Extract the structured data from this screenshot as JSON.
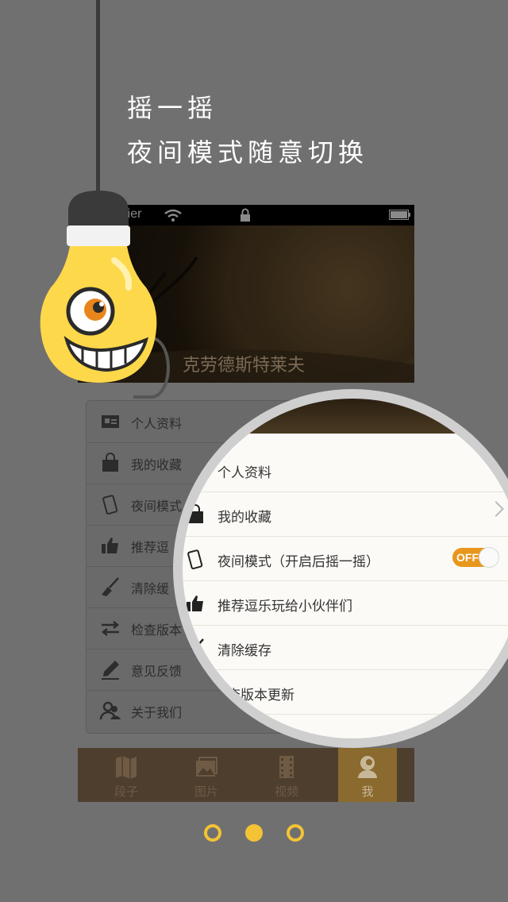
{
  "headline": {
    "line1": "摇一摇",
    "line2": "夜间模式随意切换"
  },
  "phone": {
    "status": {
      "carrier": "rrier"
    },
    "profile": {
      "username": "克劳德斯特莱夫"
    },
    "menu": [
      {
        "label": "个人资料",
        "icon": "profile-card-icon"
      },
      {
        "label": "我的收藏",
        "icon": "bag-icon"
      },
      {
        "label": "夜间模式",
        "icon": "phone-shake-icon"
      },
      {
        "label": "推荐逗",
        "icon": "thumbs-up-icon"
      },
      {
        "label": "清除缓",
        "icon": "broom-icon"
      },
      {
        "label": "检查版本",
        "icon": "swap-arrows-icon"
      },
      {
        "label": "意见反馈",
        "icon": "pen-icon"
      },
      {
        "label": "关于我们",
        "icon": "people-icon"
      }
    ],
    "tabs": [
      {
        "label": "段子",
        "icon": "map-icon",
        "active": false
      },
      {
        "label": "图片",
        "icon": "photos-icon",
        "active": false
      },
      {
        "label": "视频",
        "icon": "film-icon",
        "active": false
      },
      {
        "label": "我",
        "icon": "user-icon",
        "active": true
      }
    ]
  },
  "magnifier": {
    "items": [
      {
        "label": "个人资料",
        "icon": "profile-card-icon"
      },
      {
        "label": "我的收藏",
        "icon": "bag-icon",
        "chevron": true
      },
      {
        "label": "夜间模式（开启后摇一摇）",
        "icon": "phone-shake-icon",
        "toggle": "OFF"
      },
      {
        "label": "推荐逗乐玩给小伙伴们",
        "icon": "thumbs-up-icon"
      },
      {
        "label": "清除缓存",
        "icon": "broom-icon"
      },
      {
        "label": "查版本更新",
        "icon": "swap-arrows-icon"
      }
    ]
  },
  "pager": {
    "current": 2,
    "total": 3
  },
  "colors": {
    "accent": "#f3c335",
    "toggle": "#e8961c",
    "bulb": "#fdd84a"
  }
}
